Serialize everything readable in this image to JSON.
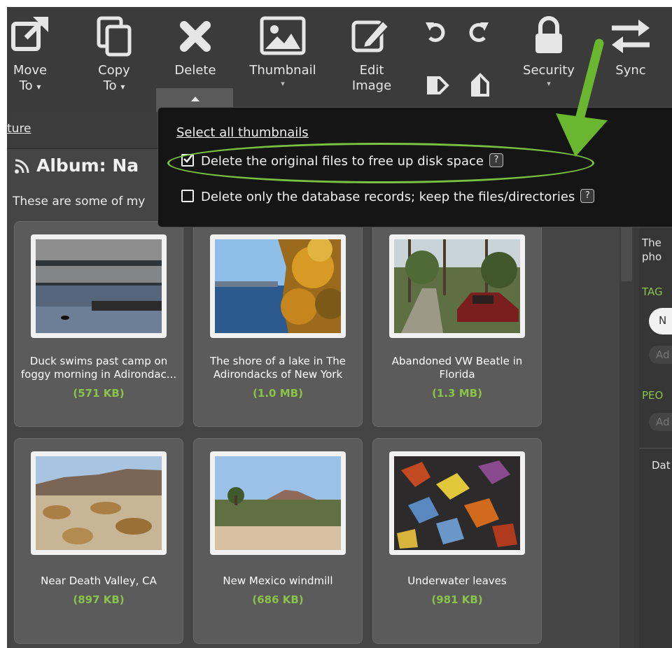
{
  "toolbar": {
    "move_label": "Move",
    "move_sub": "To",
    "copy_label": "Copy",
    "copy_sub": "To",
    "delete_label": "Delete",
    "thumbnail_label": "Thumbnail",
    "edit_label": "Edit",
    "edit_sub": "Image",
    "security_label": "Security",
    "sync_label": "Sync",
    "caret": "▾",
    "icons": [
      "move-icon",
      "copy-icon",
      "delete-icon",
      "thumbnail-icon",
      "edit-icon",
      "rotate-left-icon",
      "rotate-right-icon",
      "flip-horizontal-icon",
      "flip-vertical-icon",
      "lock-icon",
      "sync-icon"
    ]
  },
  "breadcrumb": "ture",
  "album": {
    "title_icon": "rss-icon",
    "title": "Album: Na",
    "description": "These are some of my"
  },
  "dropdown": {
    "select_all": "Select all thumbnails",
    "option_delete_files": "Delete the original files to free up disk space",
    "option_delete_files_checked": true,
    "option_delete_records": "Delete only the database records; keep the files/directories",
    "option_delete_records_checked": false,
    "help": "?"
  },
  "thumbnails": [
    {
      "caption": "Duck swims past camp on foggy morning in Adirondac...",
      "size": "(571 KB)"
    },
    {
      "caption": "The shore of a lake in The Adirondacks of New York",
      "size": "(1.0 MB)"
    },
    {
      "caption": "Abandoned VW Beatle in Florida",
      "size": "(1.3 MB)"
    },
    {
      "caption": "Near Death Valley, CA",
      "size": "(897 KB)"
    },
    {
      "caption": "New Mexico windmill",
      "size": "(686 KB)"
    },
    {
      "caption": "Underwater leaves",
      "size": "(981 KB)"
    }
  ],
  "right_panel": {
    "line1": "The",
    "line2": "pho",
    "tags_label": "TAG",
    "tag_chip": "N",
    "add_tag": "Ad",
    "people_label": "PEO",
    "add_person": "Ad",
    "date_label": "Dat"
  },
  "colors": {
    "accent_green": "#8bc34a",
    "annotation_green": "#7ac142",
    "toolbar_bg": "#3b3b3b",
    "card_bg": "#5b5b5b"
  }
}
